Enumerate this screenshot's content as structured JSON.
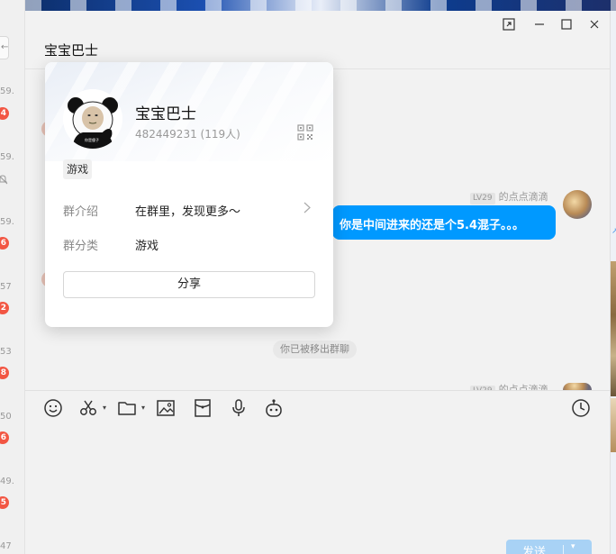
{
  "left_sidebar": {
    "back_glyph": "←",
    "items": [
      {
        "time": "59.",
        "badge": "4"
      },
      {
        "time": "59.",
        "badge": "",
        "muted": true
      },
      {
        "time": "59.",
        "badge": "6"
      },
      {
        "time": "57",
        "badge": "2"
      },
      {
        "time": "53",
        "badge": "8"
      },
      {
        "time": "50",
        "badge": "6"
      },
      {
        "time": "49.",
        "badge": "5"
      },
      {
        "time": "47",
        "badge": ""
      }
    ]
  },
  "window": {
    "title": "宝宝巴士",
    "controls": {
      "pin": "pin-window-icon",
      "minimize": "—",
      "maximize": "□",
      "close": "✕"
    }
  },
  "messages": {
    "msg1": {
      "level": "LV29",
      "sender": "的点点滴滴",
      "text": "你是中间进来的还是个5.4混子。。。"
    },
    "system_notice": "你已被移出群聊",
    "msg2": {
      "level": "LV29",
      "sender": "的点点滴滴"
    }
  },
  "toolbar": {
    "tools": [
      "emoji-icon",
      "scissors-icon",
      "folder-icon",
      "image-icon",
      "red-packet-icon",
      "microphone-icon",
      "robot-icon",
      "history-clock-icon"
    ]
  },
  "send_button": {
    "label": "发送",
    "dropdown": "▾"
  },
  "group_card": {
    "name": "宝宝巴士",
    "id_line": "482449231 (119人)",
    "tag": "游戏",
    "intro_label": "群介绍",
    "intro_value": "在群里，发现更多～",
    "category_label": "群分类",
    "category_value": "游戏",
    "share_label": "分享",
    "avatar_caption": "你是傻子"
  },
  "colors": {
    "accent": "#0099ff",
    "badge": "#f25643",
    "send_disabled": "#a8d2f5"
  }
}
